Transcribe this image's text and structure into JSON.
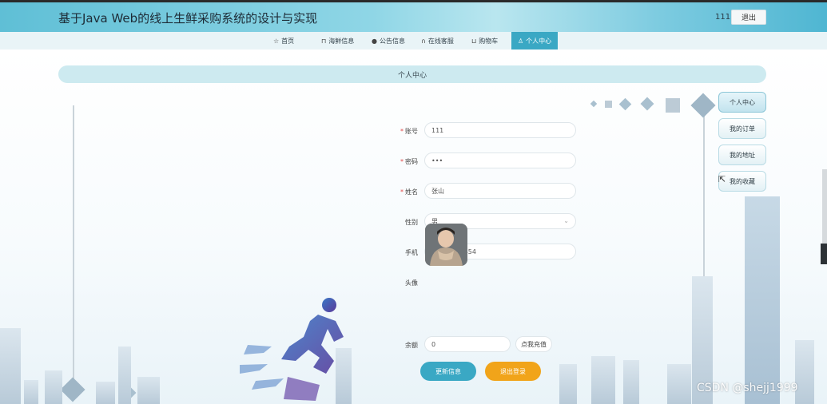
{
  "header": {
    "title": "基于Java Web的线上生鲜采购系统的设计与实现",
    "username": "111",
    "logout_label": "退出"
  },
  "nav": {
    "items": [
      {
        "label": "首页",
        "icon": "star-icon"
      },
      {
        "label": "海鲜信息",
        "icon": "bag-icon"
      },
      {
        "label": "公告信息",
        "icon": "info-icon"
      },
      {
        "label": "在线客服",
        "icon": "headset-icon"
      },
      {
        "label": "购物车",
        "icon": "cart-icon"
      },
      {
        "label": "个人中心",
        "icon": "user-icon"
      }
    ],
    "active_index": 5
  },
  "page": {
    "title": "个人中心"
  },
  "form": {
    "account": {
      "label": "账号",
      "value": "111",
      "required": true
    },
    "password": {
      "label": "密码",
      "value": "•••",
      "required": true
    },
    "name": {
      "label": "姓名",
      "value": "张山",
      "required": true
    },
    "gender": {
      "label": "性别",
      "value": "男"
    },
    "phone": {
      "label": "手机",
      "value": "18156541454"
    },
    "avatar": {
      "label": "头像"
    },
    "balance": {
      "label": "余额",
      "value": "0",
      "recharge_label": "点我充值"
    },
    "update_label": "更新信息",
    "logout_label": "退出登录"
  },
  "side_menu": {
    "items": [
      "个人中心",
      "我的订单",
      "我的地址",
      "我的收藏"
    ],
    "active_index": 0
  },
  "watermark": "CSDN @shejj1999",
  "colors": {
    "primary": "#3aa8c4",
    "accent": "#f1a41a",
    "required": "#e14a4a"
  }
}
